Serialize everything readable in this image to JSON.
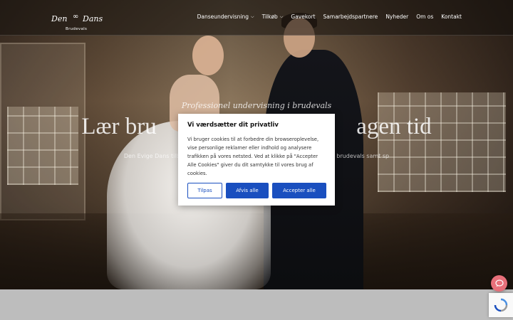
{
  "header": {
    "logo": {
      "left": "Den",
      "right": "Dans",
      "sub": "Brudevals"
    },
    "nav": [
      {
        "label": "Danseundervisning",
        "dropdown": true
      },
      {
        "label": "Tilkøb",
        "dropdown": true
      },
      {
        "label": "Gavekort",
        "dropdown": false
      },
      {
        "label": "Samarbejdspartnere",
        "dropdown": false
      },
      {
        "label": "Nyheder",
        "dropdown": false
      },
      {
        "label": "Om os",
        "dropdown": false
      },
      {
        "label": "Kontakt",
        "dropdown": false
      }
    ]
  },
  "hero": {
    "tagline": "Professionel undervisning i brudevals",
    "headline": "Lær bru                                  agen tid",
    "subtext": "Den Evige Dans tilbyd                                                                       mukke brudevals samt sp                                                                              ik."
  },
  "cookie": {
    "title": "Vi værdsætter dit privatliv",
    "text": "Vi bruger cookies til at forbedre din browseroplevelse, vise personlige reklamer eller indhold og analysere trafikken på vores netsted. Ved at klikke på \"Accepter Alle Cookies\" giver du dit samtykke til vores brug af cookies.",
    "customize_label": "Tilpas",
    "reject_label": "Afvis alle",
    "accept_label": "Accepter alle"
  },
  "colors": {
    "accent": "#1a4fbf",
    "chat": "#e8707a"
  },
  "icons": {
    "logo": "infinity-icon",
    "chat": "chat-bubble-icon",
    "recaptcha": "recaptcha-icon"
  }
}
